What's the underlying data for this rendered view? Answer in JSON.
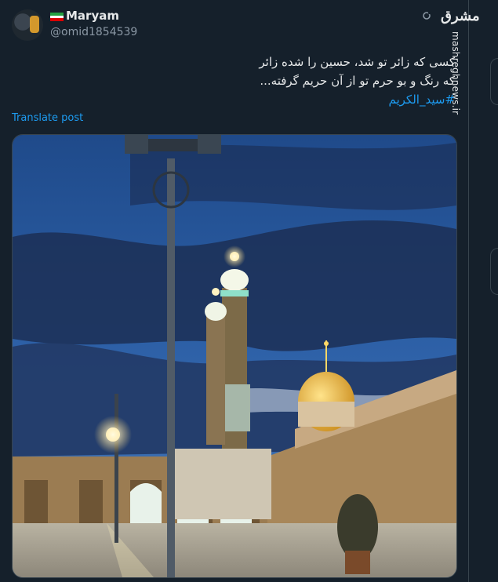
{
  "author": {
    "name": "Maryam",
    "handle": "@omid1854539",
    "flag": "iran-flag"
  },
  "watermark": {
    "logo_text": "مشرق",
    "url": "mashreghnews.ir"
  },
  "tweet": {
    "line1": "کسی که زائر تو شد، حسین را شده زائر",
    "line2": "که رنگ و بو حرم تو از آن حریم گرفته...",
    "hashtag": "#سید_الکریم"
  },
  "translate_label": "Translate post",
  "photo": {
    "subject": "shrine-at-dusk-image"
  },
  "colors": {
    "accent": "#1d9bf0",
    "background": "#15202b",
    "text": "#e7e9ea",
    "muted": "#8b98a5"
  },
  "icons": [
    "more-icon"
  ]
}
